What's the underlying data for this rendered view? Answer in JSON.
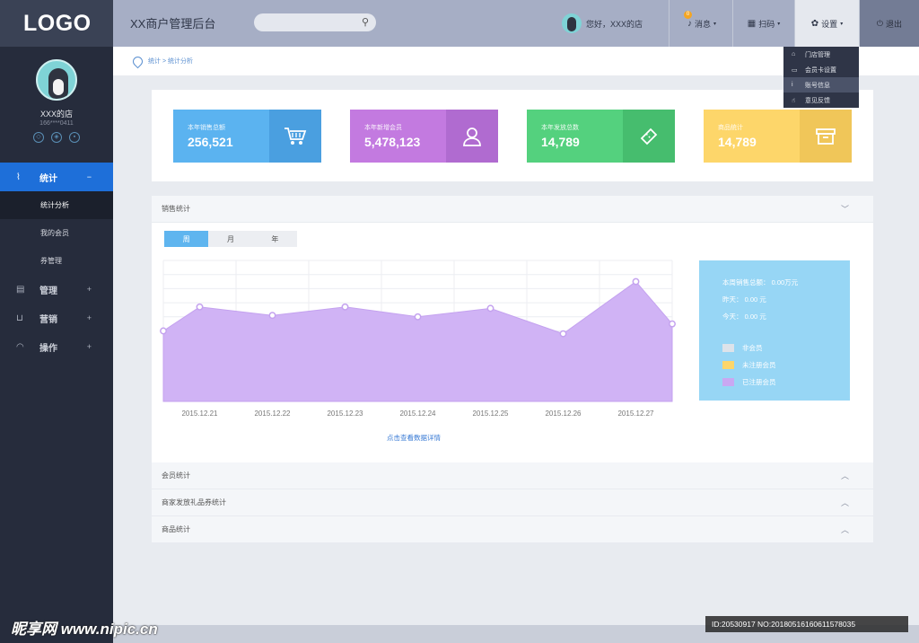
{
  "logo": "LOGO",
  "profile": {
    "name": "XXX的店",
    "phone": "166****0411"
  },
  "nav": [
    {
      "label": "统计",
      "icon": "chart-icon",
      "sign": "−",
      "active": true
    },
    {
      "label": "管理",
      "icon": "clipboard-icon",
      "sign": "+"
    },
    {
      "label": "营销",
      "icon": "cart-icon",
      "sign": "+"
    },
    {
      "label": "操作",
      "icon": "gauge-icon",
      "sign": "+"
    }
  ],
  "subnav": [
    "统计分析",
    "我的会员",
    "券管理"
  ],
  "header": {
    "title": "XX商户管理后台",
    "greeting": "您好，XXX的店",
    "messages": "消息",
    "message_badge": "0",
    "scan": "扫码",
    "settings": "设置",
    "logout": "退出"
  },
  "settings_menu": [
    "门店管理",
    "会员卡设置",
    "账号信息",
    "意见反馈"
  ],
  "breadcrumb": "统计 > 统计分析",
  "stats": [
    {
      "title": "本年销售总额",
      "value": "256,521",
      "color": "#5bb3f0",
      "iconbg": "#4a9fe0",
      "icon": "cart-icon"
    },
    {
      "title": "本年新增会员",
      "value": "5,478,123",
      "color": "#c37ae0",
      "iconbg": "#b06bd0",
      "icon": "user-icon"
    },
    {
      "title": "本年发放总数",
      "value": "14,789",
      "color": "#54d17e",
      "iconbg": "#46bd6e",
      "icon": "ticket-icon"
    },
    {
      "title": "商品统计",
      "value": "14,789",
      "color": "#fdd66a",
      "iconbg": "#f0c659",
      "icon": "box-icon"
    }
  ],
  "sales_panel": {
    "title": "销售统计",
    "tabs": [
      "周",
      "月",
      "年"
    ],
    "detail_link": "点击查看数据详情",
    "summary": [
      "本周销售总额： 0.00万元",
      "昨天： 0.00 元",
      "今天： 0.00 元"
    ],
    "legend": [
      {
        "name": "非会员",
        "color": "#dde3ea"
      },
      {
        "name": "未注册会员",
        "color": "#fdd66a"
      },
      {
        "name": "已注册会员",
        "color": "#c9a8f2"
      }
    ]
  },
  "chart_data": {
    "type": "area",
    "x": [
      "2015.12.21",
      "2015.12.22",
      "2015.12.23",
      "2015.12.24",
      "2015.12.25",
      "2015.12.26",
      "2015.12.27"
    ],
    "points": [
      {
        "x": 0.0,
        "y": 50
      },
      {
        "x": 0.5,
        "y": 67
      },
      {
        "x": 1.5,
        "y": 61
      },
      {
        "x": 2.5,
        "y": 67
      },
      {
        "x": 3.5,
        "y": 60
      },
      {
        "x": 4.5,
        "y": 66
      },
      {
        "x": 5.5,
        "y": 48
      },
      {
        "x": 6.5,
        "y": 85
      },
      {
        "x": 7.0,
        "y": 55
      }
    ],
    "ylim": [
      0,
      100
    ],
    "grid": true
  },
  "collapsed_panels": [
    "会员统计",
    "商家发放礼品券统计",
    "商品统计"
  ],
  "watermark": {
    "left": "昵享网 www.nipic.cn",
    "right": "ID:20530917 NO:20180516160611578035"
  }
}
